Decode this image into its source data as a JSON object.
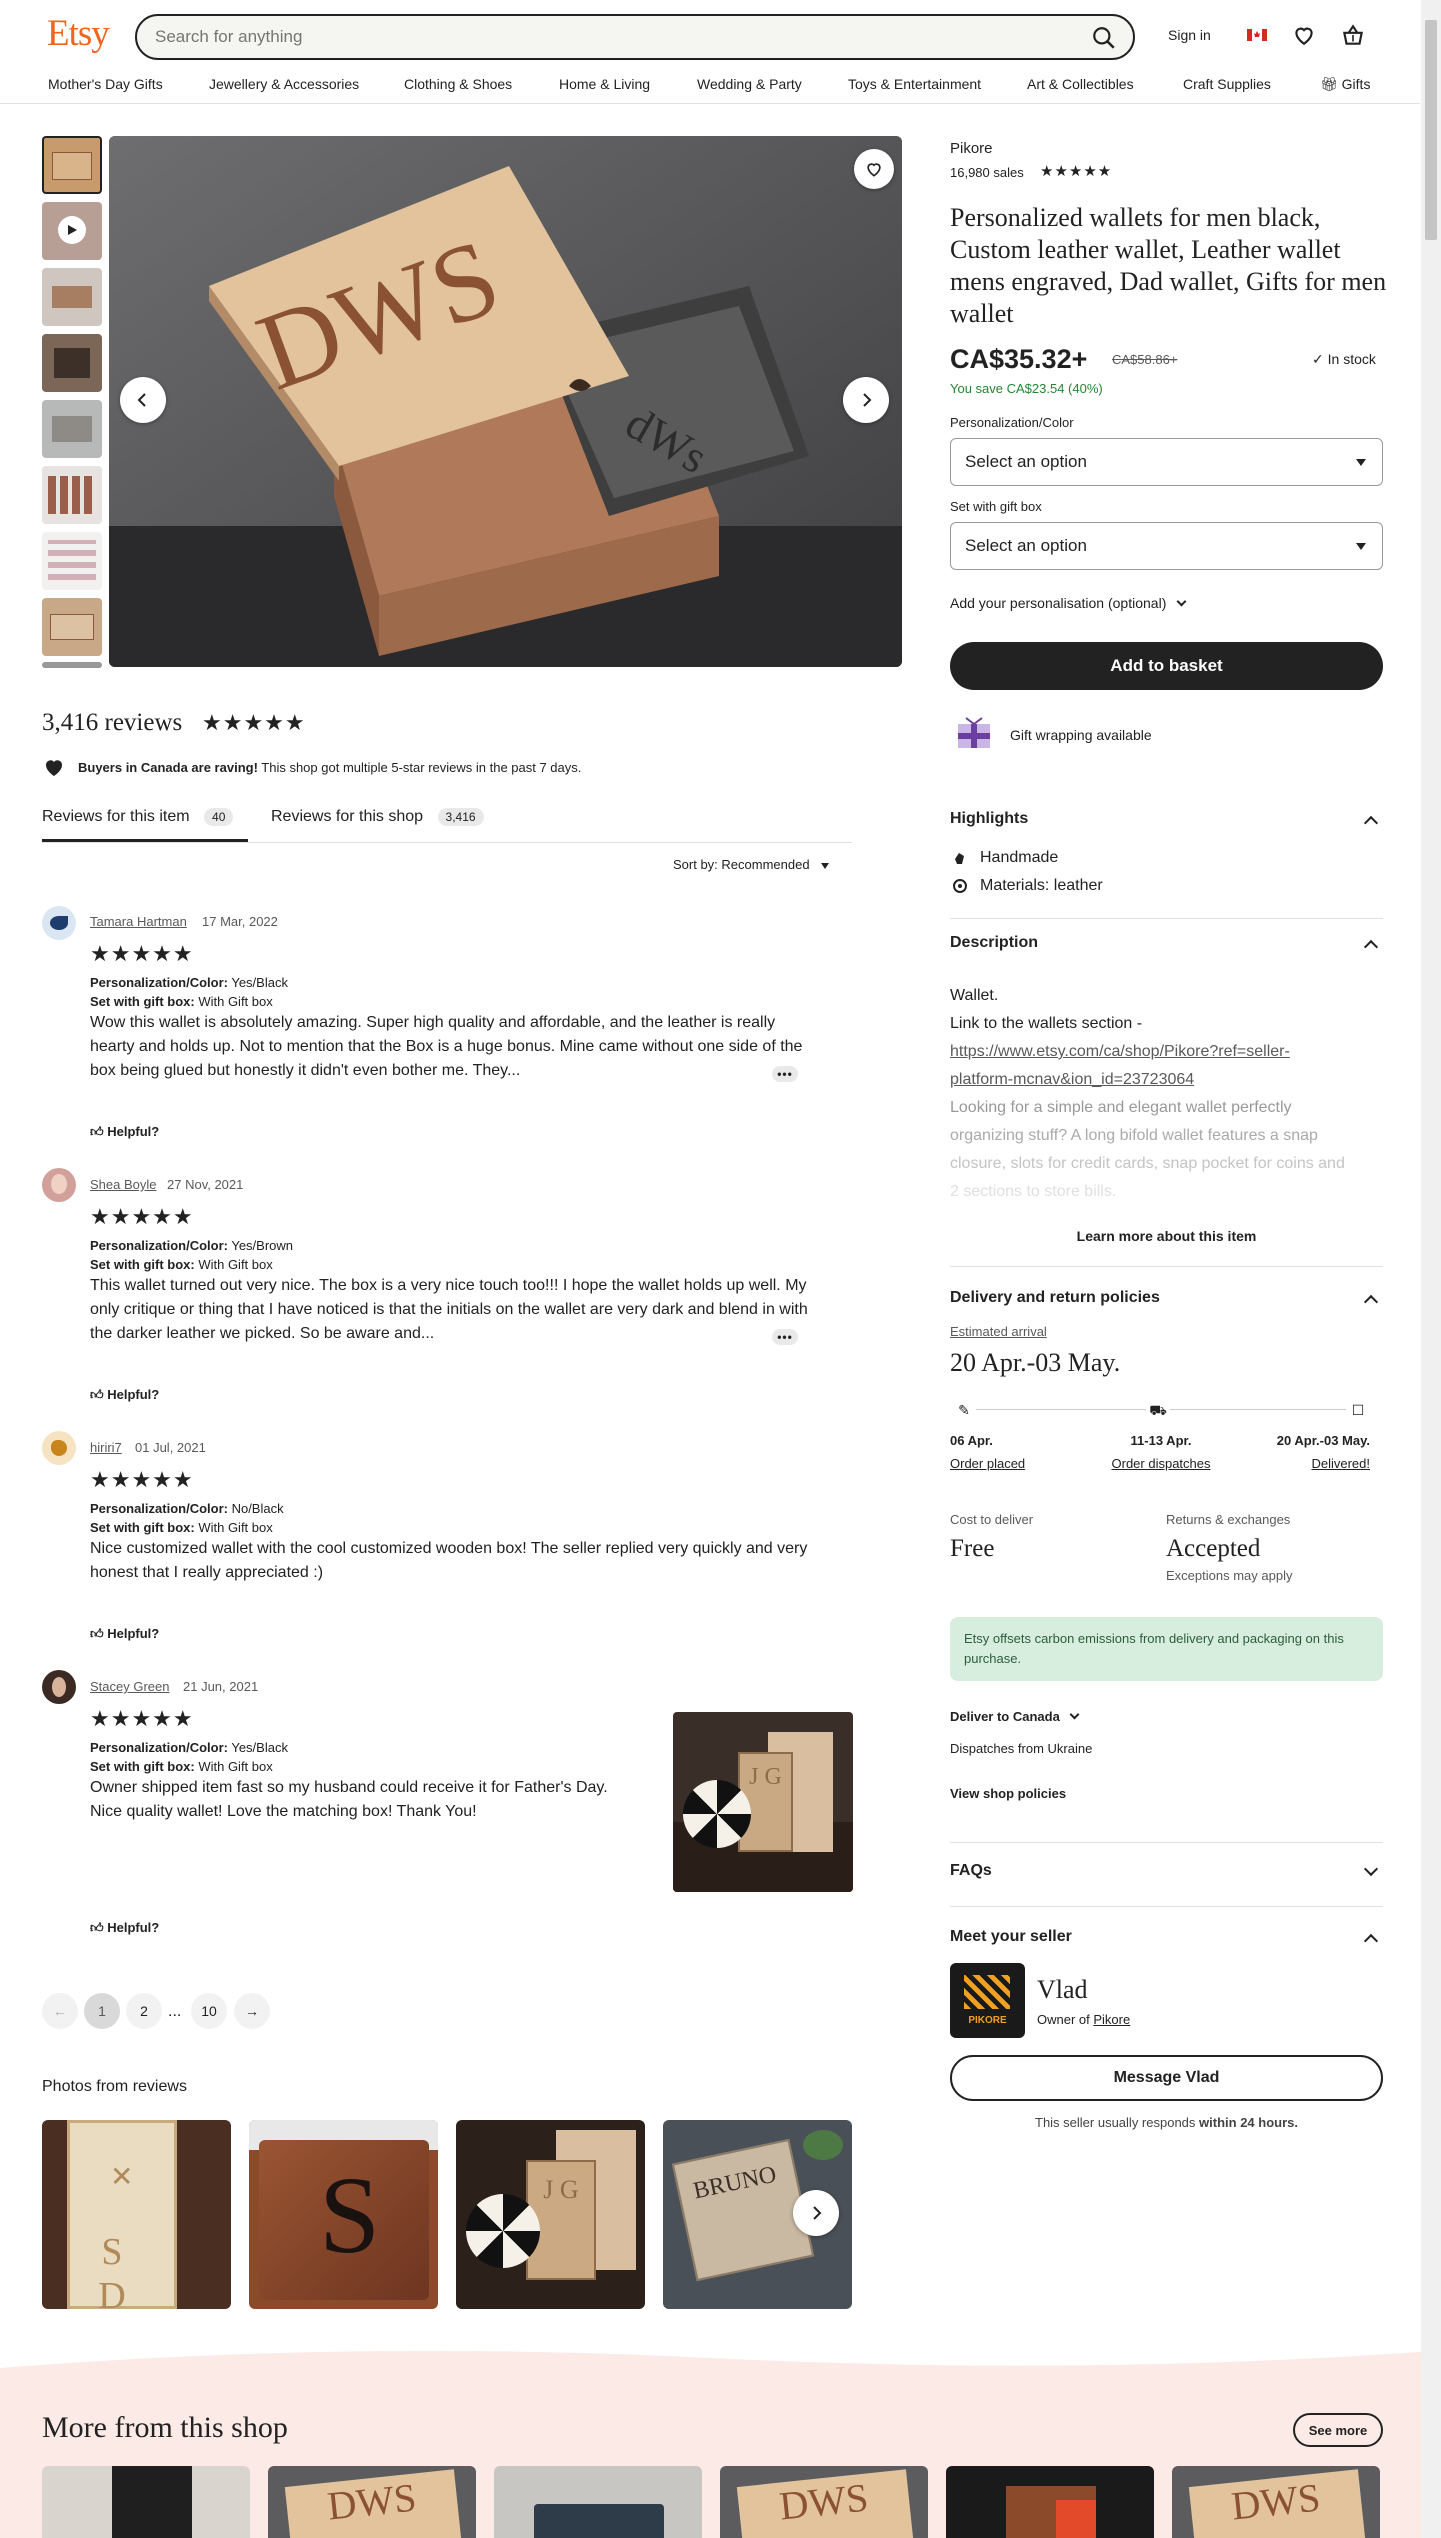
{
  "header": {
    "logo": "Etsy",
    "search_placeholder": "Search for anything",
    "sign_in": "Sign in"
  },
  "categories": [
    "Mother's Day Gifts",
    "Jewellery & Accessories",
    "Clothing & Shoes",
    "Home & Living",
    "Wedding & Party",
    "Toys & Entertainment",
    "Art & Collectibles",
    "Craft Supplies",
    "Gifts"
  ],
  "product": {
    "shop_name": "Pikore",
    "sales": "16,980 sales",
    "stars": "★★★★★",
    "title": "Personalized wallets for men black, Custom leather wallet, Leather wallet mens engraved, Dad wallet, Gifts for men wallet",
    "price": "CA$35.32+",
    "original_price": "CA$58.86+",
    "in_stock": "In stock",
    "savings": "You save CA$23.54 (40%)",
    "option1_label": "Personalization/Color",
    "option1_value": "Select an option",
    "option2_label": "Set with gift box",
    "option2_value": "Select an option",
    "personalisation": "Add your personalisation (optional)",
    "add_to_basket": "Add to basket",
    "gift_wrapping": "Gift wrapping available",
    "image_text": "DWS",
    "image_text_small": "dWs"
  },
  "highlights": {
    "title": "Highlights",
    "items": [
      "Handmade",
      "Materials: leather"
    ]
  },
  "description": {
    "title": "Description",
    "line1": "Wallet.",
    "line2": "Link to the wallets section -",
    "link1": "https://www.etsy.com/ca/shop/Pikore?ref=seller-",
    "link2": "platform-mcnav&ion_id=23723064",
    "faded1": "Looking for a simple and elegant wallet perfectly",
    "faded2": "organizing stuff? A long bifold wallet features a snap",
    "faded3": "closure, slots for credit cards, snap pocket for coins and",
    "faded4": "2 sections to store bills.",
    "learn_more": "Learn more about this item"
  },
  "delivery": {
    "title": "Delivery and return policies",
    "estimated_label": "Estimated arrival",
    "estimated_dates": "20 Apr.-03 May.",
    "steps": [
      {
        "date": "06 Apr.",
        "label": "Order placed"
      },
      {
        "date": "11-13 Apr.",
        "label": "Order dispatches"
      },
      {
        "date": "20 Apr.-03 May.",
        "label": "Delivered!"
      }
    ],
    "cost_label": "Cost to deliver",
    "cost_value": "Free",
    "returns_label": "Returns & exchanges",
    "returns_value": "Accepted",
    "returns_note": "Exceptions may apply",
    "carbon_note": "Etsy offsets carbon emissions from delivery and packaging on this purchase.",
    "deliver_to": "Deliver to Canada",
    "dispatches_from": "Dispatches from Ukraine",
    "view_policies": "View shop policies"
  },
  "faqs": {
    "title": "FAQs"
  },
  "seller": {
    "title": "Meet your seller",
    "name": "Vlad",
    "owner_of": "Owner of",
    "shop": "Pikore",
    "logo_text": "PIKORE",
    "message_button": "Message Vlad",
    "response_pre": "This seller usually responds ",
    "response_bold": "within 24 hours."
  },
  "reviews": {
    "count": "3,416 reviews",
    "stars": "★★★★★",
    "raving_bold": "Buyers in Canada are raving!",
    "raving_text": " This shop got multiple 5-star reviews in the past 7 days.",
    "tab_item": "Reviews for this item",
    "tab_item_count": "40",
    "tab_shop": "Reviews for this shop",
    "tab_shop_count": "3,416",
    "sort": "Sort by: Recommended",
    "list": [
      {
        "name": "Tamara Hartman",
        "date": "17 Mar, 2022",
        "opt1_label": "Personalization/Color:",
        "opt1": " Yes/Black",
        "opt2_label": "Set with gift box:",
        "opt2": " With Gift box",
        "text": "Wow this wallet is absolutely amazing. Super high quality and affordable, and the leather is really hearty and holds up. Not to mention that the Box is a huge bonus. Mine came without one side of the box being glued but honestly it didn't even bother me. They...",
        "helpful": "Helpful?"
      },
      {
        "name": "Shea Boyle",
        "date": "27 Nov, 2021",
        "opt1_label": "Personalization/Color:",
        "opt1": " Yes/Brown",
        "opt2_label": "Set with gift box:",
        "opt2": " With Gift box",
        "text": "This wallet turned out very nice. The box is a very nice touch too!!! I hope the wallet holds up well. My only critique or thing that I have noticed is that the initials on the wallet are very dark and blend in with the darker leather we picked. So be aware and...",
        "helpful": "Helpful?"
      },
      {
        "name": "hiriri7",
        "date": "01 Jul, 2021",
        "opt1_label": "Personalization/Color:",
        "opt1": " No/Black",
        "opt2_label": "Set with gift box:",
        "opt2": " With Gift box",
        "text": "Nice customized wallet with the cool customized wooden box! The seller replied very quickly and very honest that I really appreciated :)",
        "helpful": "Helpful?"
      },
      {
        "name": "Stacey Green",
        "date": "21 Jun, 2021",
        "opt1_label": "Personalization/Color:",
        "opt1": " Yes/Black",
        "opt2_label": "Set with gift box:",
        "opt2": " With Gift box",
        "text": "Owner shipped item fast so my husband could receive it for Father's Day. Nice quality wallet! Love the matching box! Thank You!",
        "helpful": "Helpful?"
      }
    ],
    "pagination": [
      "1",
      "2",
      "...",
      "10"
    ]
  },
  "photos_from_reviews": {
    "title": "Photos from reviews",
    "photo1_text": "S D",
    "photo2_text": "S",
    "photo4_text": "BRUNO",
    "photo3_text": "J G"
  },
  "more_from_shop": {
    "title": "More from this shop",
    "see_more": "See more",
    "tile_text": "DWS"
  }
}
